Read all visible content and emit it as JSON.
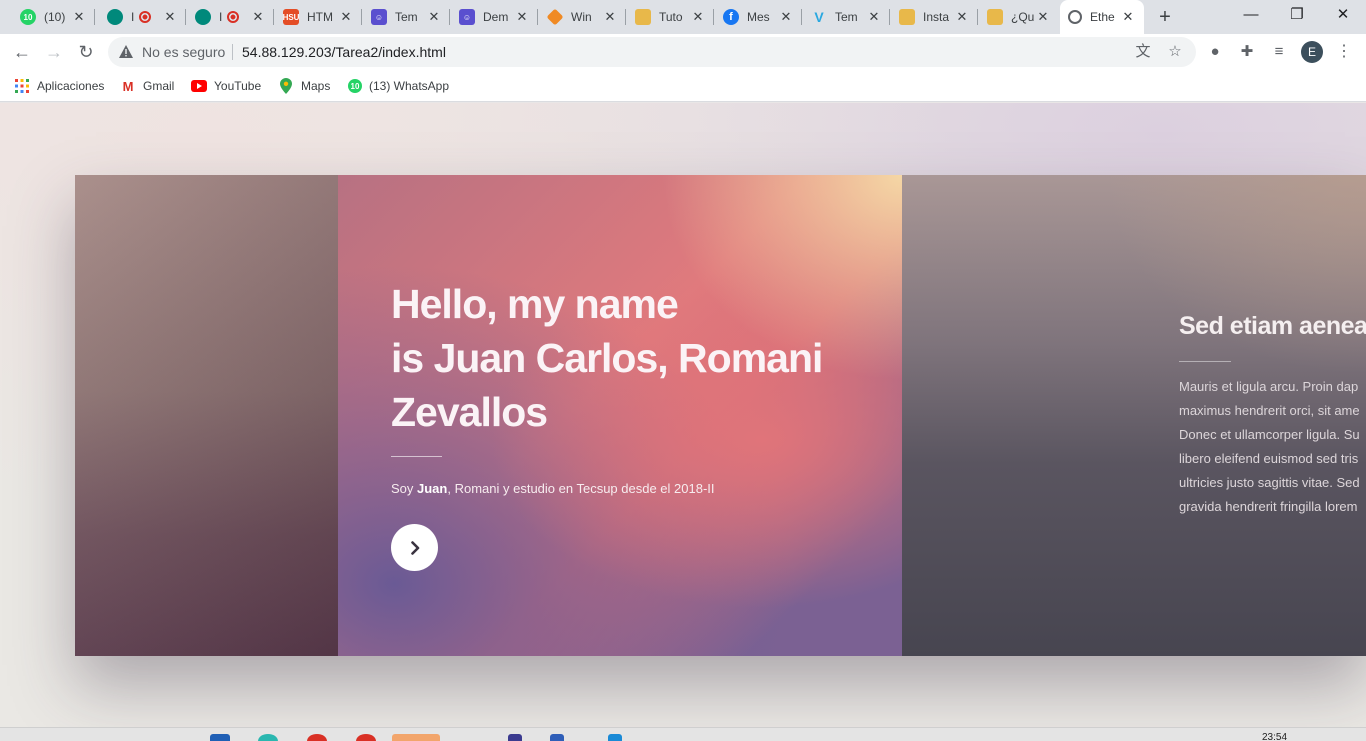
{
  "tabs": [
    {
      "title": "(10)",
      "favicon": "whatsapp-icon",
      "color": "#25d366",
      "badge": "10"
    },
    {
      "title": "I",
      "favicon": "meet-record-icon",
      "color": "#00897b"
    },
    {
      "title": "I",
      "favicon": "meet-record-icon",
      "color": "#00897b"
    },
    {
      "title": "HTM",
      "favicon": "html-site-icon",
      "color": "#e44d26",
      "badge": "HSU"
    },
    {
      "title": "Tem",
      "favicon": "template-icon",
      "color": "#5a4fcf"
    },
    {
      "title": "Dem",
      "favicon": "template-icon",
      "color": "#5a4fcf"
    },
    {
      "title": "Win",
      "favicon": "diamond-icon",
      "color": "#f08a24"
    },
    {
      "title": "Tuto",
      "favicon": "box-icon",
      "color": "#e8b84a"
    },
    {
      "title": "Mes",
      "favicon": "facebook-icon",
      "color": "#1877f2"
    },
    {
      "title": "Tem",
      "favicon": "v-icon",
      "color": "#2aa8e0"
    },
    {
      "title": "Insta",
      "favicon": "box-icon",
      "color": "#e8b84a"
    },
    {
      "title": "¿Qu",
      "favicon": "box-icon",
      "color": "#e8b84a"
    },
    {
      "title": "Ethe",
      "favicon": "globe-icon",
      "color": "#5f6368",
      "active": true
    }
  ],
  "toolbar": {
    "security_label": "No es seguro",
    "url": "54.88.129.203/Tarea2/index.html",
    "avatar_letter": "E"
  },
  "bookmarks": [
    {
      "label": "Aplicaciones",
      "icon": "apps-grid-icon"
    },
    {
      "label": "Gmail",
      "icon": "gmail-icon"
    },
    {
      "label": "YouTube",
      "icon": "youtube-icon"
    },
    {
      "label": "Maps",
      "icon": "maps-pin-icon"
    },
    {
      "label": "(13) WhatsApp",
      "icon": "whatsapp-icon"
    }
  ],
  "hero": {
    "title_line1": "Hello, my name",
    "title_line2": "is Juan Carlos, Romani",
    "title_line3": "Zevallos",
    "text_prefix": "Soy ",
    "text_bold": "Juan",
    "text_suffix": ", Romani y estudio en Tecsup desde el 2018-II"
  },
  "side_slide": {
    "title": "Sed etiam aenea",
    "lines": [
      "Mauris et ligula arcu. Proin dap",
      "maximus hendrerit orci, sit ame",
      "Donec et ullamcorper ligula. Su",
      "libero eleifend euismod sed tris",
      "ultricies justo sagittis vitae. Sed",
      "gravida hendrerit fringilla lorem"
    ]
  },
  "taskbar": {
    "clock": "23:54"
  }
}
